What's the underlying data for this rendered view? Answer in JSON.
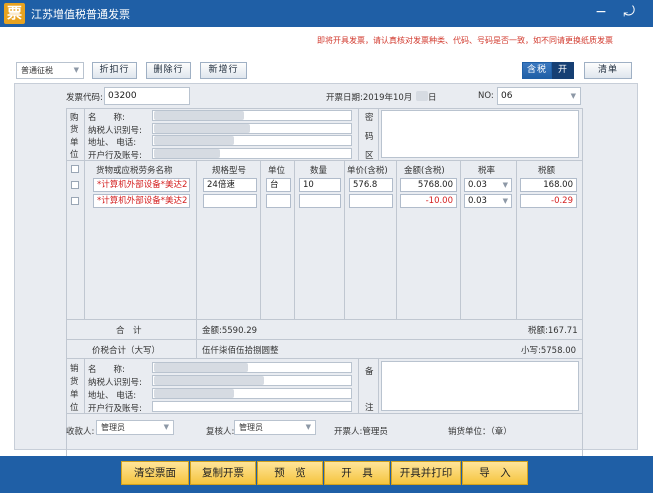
{
  "window": {
    "title": "江苏增值税普通发票",
    "controls": "− ⤾"
  },
  "notice": "即将开具发票，请认真核对发票种类、代码、号码是否一致，如不同请更换纸质发票",
  "toolbar": {
    "levy_type": "普通征税",
    "add_row": "折扣行",
    "delete_row": "删除行",
    "new_row": "新增行",
    "tax_incl": "含税",
    "tax_incl_state": "开",
    "list": "清单"
  },
  "header": {
    "code_label": "发票代码:",
    "code_value": "03200",
    "date_label": "开票日期:2019年10月",
    "date_suffix": "日",
    "no_label": "NO:",
    "no_value": "06"
  },
  "buyer": {
    "side": [
      "购",
      "货",
      "单",
      "位"
    ],
    "name_label": "名　　称:",
    "taxid_label": "纳税人识别号:",
    "addr_label": "地址、 电话:",
    "bank_label": "开户行及账号:",
    "pwd_side": [
      "密",
      "码",
      "区"
    ]
  },
  "table": {
    "headers": [
      "货物或应税劳务名称",
      "规格型号",
      "单位",
      "数量",
      "单价(含税)",
      "金额(含税)",
      "税率",
      "税额"
    ],
    "rows": [
      {
        "name": "*计算机外部设备*美达2",
        "spec": "24倍速",
        "unit": "台",
        "qty": "10",
        "price": "576.8",
        "amount": "5768.00",
        "rate": "0.03",
        "tax": "168.00"
      },
      {
        "name": "*计算机外部设备*美达2",
        "spec": "",
        "unit": "",
        "qty": "",
        "price": "",
        "amount": "-10.00",
        "rate": "0.03",
        "tax": "-0.29"
      }
    ],
    "total_label": "合　计",
    "total_amount": "金额:5590.29",
    "total_tax": "税额:167.71",
    "pricesum_label": "价税合计（大写）",
    "pricesum_upper": "伍仟柒佰伍拾捌圆整",
    "pricesum_lower": "小写:5758.00"
  },
  "seller": {
    "side": [
      "销",
      "货",
      "单",
      "位"
    ],
    "name_label": "名　　称:",
    "taxid_label": "纳税人识别号:",
    "addr_label": "地址、 电话:",
    "bank_label": "开户行及账号:",
    "note_side": [
      "备",
      "注"
    ]
  },
  "footer": {
    "payee_label": "收款人:",
    "payee_value": "管理员",
    "reviewer_label": "复核人:",
    "reviewer_value": "管理员",
    "drawer_label": "开票人:管理员",
    "seller_unit_label": "销货单位：（章）"
  },
  "actions": [
    "清空票面",
    "复制开票",
    "预　览",
    "开　具",
    "开具并打印",
    "导　入"
  ],
  "colors": {
    "titlebar": "#1f5fa6",
    "accent_button": "#f5c43e",
    "notice": "#d23a2e",
    "negative": "#d42020"
  }
}
